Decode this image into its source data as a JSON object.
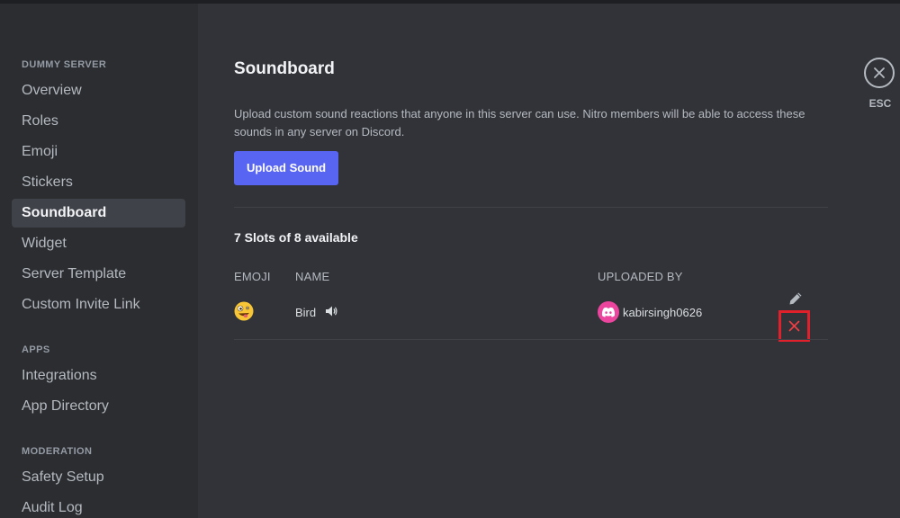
{
  "sidebar": {
    "sections": [
      {
        "header": "DUMMY SERVER",
        "items": [
          {
            "label": "Overview"
          },
          {
            "label": "Roles"
          },
          {
            "label": "Emoji"
          },
          {
            "label": "Stickers"
          },
          {
            "label": "Soundboard",
            "selected": true
          },
          {
            "label": "Widget"
          },
          {
            "label": "Server Template"
          },
          {
            "label": "Custom Invite Link"
          }
        ]
      },
      {
        "header": "APPS",
        "items": [
          {
            "label": "Integrations"
          },
          {
            "label": "App Directory"
          }
        ]
      },
      {
        "header": "MODERATION",
        "items": [
          {
            "label": "Safety Setup"
          },
          {
            "label": "Audit Log"
          }
        ]
      }
    ]
  },
  "main": {
    "title": "Soundboard",
    "description": "Upload custom sound reactions that anyone in this server can use. Nitro members will be able to access these sounds in any server on Discord.",
    "upload_button": "Upload Sound",
    "slots_text": "7 Slots of 8 available",
    "table": {
      "headers": {
        "emoji": "EMOJI",
        "name": "NAME",
        "uploaded_by": "UPLOADED BY"
      },
      "rows": [
        {
          "emoji_icon": "zany-face-icon",
          "name": "Bird",
          "uploader": "kabirsingh0626",
          "uploader_avatar_icon": "discord-logo-icon"
        }
      ]
    }
  },
  "close": {
    "label": "ESC"
  },
  "colors": {
    "accent": "#5865f2",
    "avatar": "#eb459e",
    "highlight_box": "#e0202a",
    "background": "#313338",
    "sidebar": "#2b2d31"
  }
}
